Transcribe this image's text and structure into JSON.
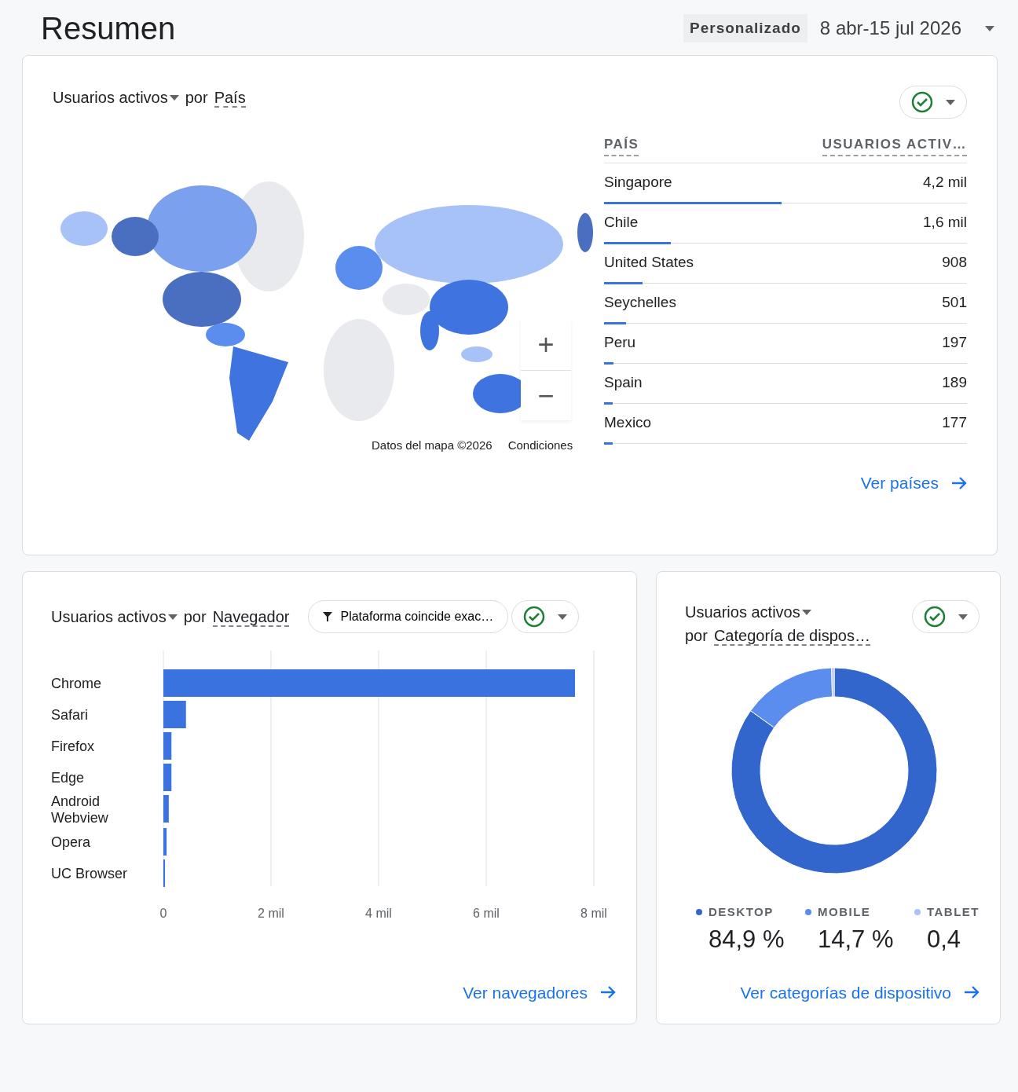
{
  "page_title": "Resumen",
  "date_range": {
    "preset": "Personalizado",
    "range": "8 abr-15 jul 2026"
  },
  "country_card": {
    "metric": "Usuarios activos",
    "by": "por",
    "dimension": "País",
    "zoom_in": "+",
    "zoom_out": "−",
    "map_credits": [
      "Datos del mapa ©2026",
      "Condiciones"
    ],
    "table": {
      "columns": [
        "PAÍS",
        "USUARIOS ACTIV…"
      ],
      "rows": [
        {
          "country": "Singapore",
          "users": "4,2 mil",
          "level": 0.49
        },
        {
          "country": "Chile",
          "users": "1,6 mil",
          "level": 0.185
        },
        {
          "country": "United States",
          "users": "908",
          "level": 0.107
        },
        {
          "country": "Seychelles",
          "users": "501",
          "level": 0.06
        },
        {
          "country": "Peru",
          "users": "197",
          "level": 0.025
        },
        {
          "country": "Spain",
          "users": "189",
          "level": 0.024
        },
        {
          "country": "Mexico",
          "users": "177",
          "level": 0.023
        }
      ]
    },
    "link": "Ver países"
  },
  "browser_card": {
    "metric": "Usuarios activos",
    "by": "por",
    "dimension": "Navegador",
    "filter": "Plataforma coincide exac…",
    "chart_data": {
      "type": "bar",
      "orientation": "horizontal",
      "categories": [
        "Chrome",
        "Safari",
        "Firefox",
        "Edge",
        "Android Webview",
        "Opera",
        "UC Browser"
      ],
      "grid": true,
      "values": [
        7.65,
        0.42,
        0.15,
        0.15,
        0.1,
        0.06,
        0.03
      ],
      "xlim": [
        0,
        8
      ],
      "xticks": [
        {
          "value": 0,
          "label": "0"
        },
        {
          "value": 2,
          "label": "2 mil"
        },
        {
          "value": 4,
          "label": "4 mil"
        },
        {
          "value": 6,
          "label": "6 mil"
        },
        {
          "value": 8,
          "label": "8 mil"
        }
      ]
    },
    "link": "Ver navegadores"
  },
  "device_card": {
    "metric": "Usuarios activos",
    "by": "por",
    "dimension": "Categoría de dispos…",
    "chart_data": {
      "type": "donut",
      "categories": [
        "DESKTOP",
        "MOBILE",
        "TABLET"
      ],
      "values": [
        84.9,
        14.7,
        0.4
      ]
    },
    "legend": [
      {
        "value": "84,9 %",
        "color": "#3366cc"
      },
      {
        "value": "14,7 %",
        "color": "#5b8def"
      },
      {
        "value": "0,4",
        "color": "#a7c2f7"
      }
    ],
    "link": "Ver categorías de dispositivo"
  }
}
